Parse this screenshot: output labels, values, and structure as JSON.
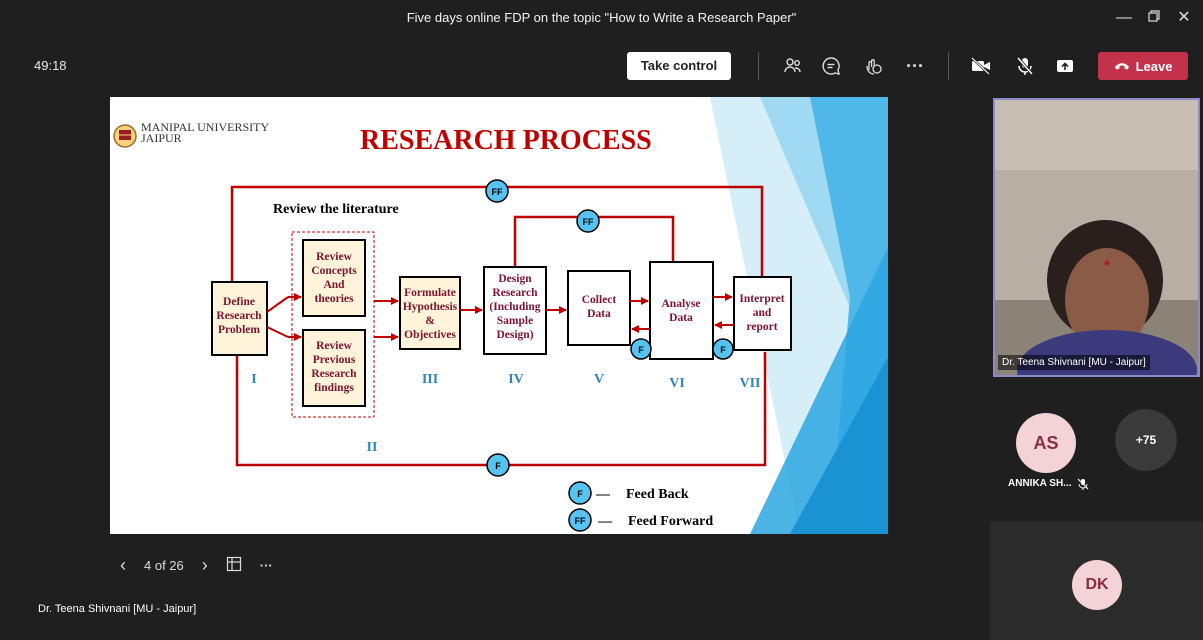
{
  "window": {
    "title": "Five days online FDP on the topic \"How to Write a Research Paper\""
  },
  "toolbar": {
    "timer": "49:18",
    "take_control_label": "Take control",
    "leave_label": "Leave"
  },
  "slide": {
    "university_line1": "MANIPAL UNIVERSITY",
    "university_line2": "JAIPUR",
    "heading": "RESEARCH PROCESS",
    "review_literature": "Review the literature",
    "box_define": [
      "Define",
      "Research",
      "Problem"
    ],
    "box_review_concepts": [
      "Review",
      "Concepts",
      "And",
      "theories"
    ],
    "box_review_previous": [
      "Review",
      "Previous",
      "Research",
      "findings"
    ],
    "box_formulate": [
      "Formulate",
      "Hypothesis",
      "&",
      "Objectives"
    ],
    "box_design": [
      "Design",
      "Research",
      "(Including",
      "Sample",
      "Design)"
    ],
    "box_collect": [
      "Collect",
      "Data"
    ],
    "box_analyse": [
      "Analyse",
      "Data"
    ],
    "box_interpret": [
      "Interpret",
      "and",
      "report"
    ],
    "step_I": "I",
    "step_II": "II",
    "step_III": "III",
    "step_IV": "IV",
    "step_V": "V",
    "step_VI": "VI",
    "step_VII": "VII",
    "marker_ff": "FF",
    "marker_f": "F",
    "legend_feedback": "Feed Back",
    "legend_feedforward": "Feed Forward",
    "legend_dash": "—"
  },
  "pager": {
    "page": "4 of 26"
  },
  "presenter_name": "Dr. Teena Shivnani [MU - Jaipur]",
  "participants": {
    "video_label": "Dr. Teena Shivnani [MU - Jaipur]",
    "as_initials": "AS",
    "as_name": "ANNIKA SH...",
    "more_count": "+75",
    "dk_initials": "DK"
  },
  "colors": {
    "accent_red": "#c4314b",
    "diagram_red": "#c00000",
    "marker_blue": "#56c4f0",
    "heading_red": "#c00000"
  }
}
